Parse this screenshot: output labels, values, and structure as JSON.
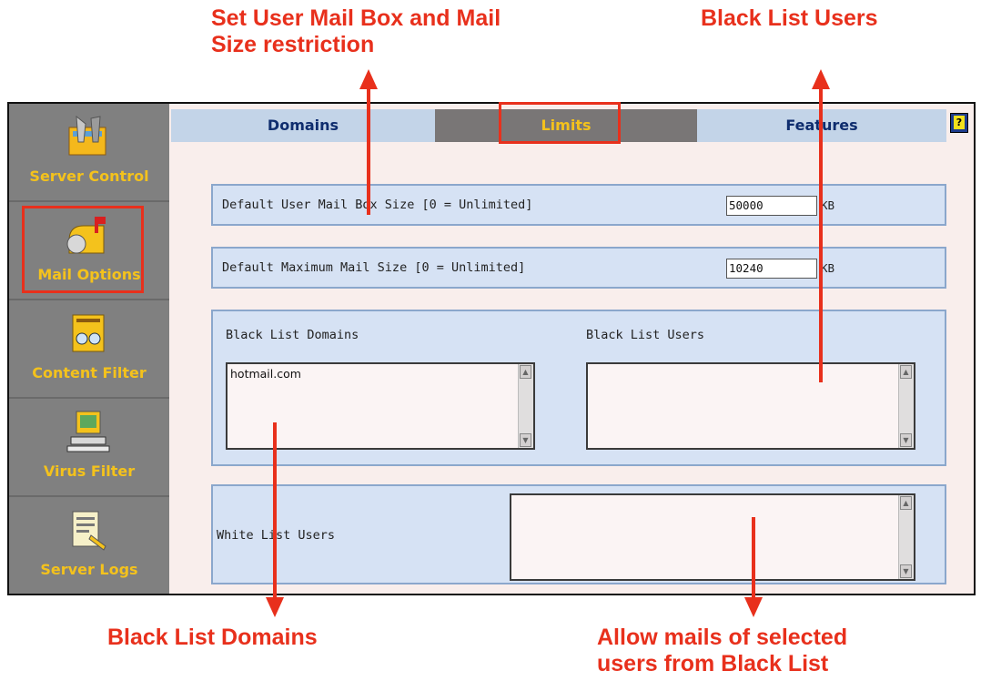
{
  "callouts": {
    "top_left_line1": "Set User Mail Box and Mail",
    "top_left_line2": "Size restriction",
    "top_right": "Black List Users",
    "bottom_left": "Black List Domains",
    "bottom_right_line1": "Allow mails of selected",
    "bottom_right_line2": "users from Black List"
  },
  "sidebar": {
    "items": [
      {
        "label": "Server Control",
        "icon": "server-control-icon"
      },
      {
        "label": "Mail Options",
        "icon": "mailbox-icon"
      },
      {
        "label": "Content Filter",
        "icon": "content-filter-icon"
      },
      {
        "label": "Virus Filter",
        "icon": "virus-filter-icon"
      },
      {
        "label": "Server Logs",
        "icon": "server-logs-icon"
      }
    ]
  },
  "tabs": {
    "domains": "Domains",
    "limits": "Limits",
    "features": "Features",
    "help": "?"
  },
  "limits": {
    "mailbox_size_label": "Default User Mail Box Size [0 = Unlimited]",
    "mailbox_size_value": "50000",
    "mailbox_size_unit": "KB",
    "max_mail_size_label": "Default Maximum Mail Size [0 = Unlimited]",
    "max_mail_size_value": "10240",
    "max_mail_size_unit": "KB"
  },
  "blacklist": {
    "domains_label": "Black List Domains",
    "domains_items": [
      "hotmail.com"
    ],
    "users_label": "Black List Users",
    "users_items": []
  },
  "whitelist": {
    "users_label": "White List Users",
    "users_items": []
  },
  "colors": {
    "callout": "#e8301c",
    "sidebar_bg": "#808080",
    "sidebar_label": "#f4c21c",
    "tab_inactive": "#c3d4e8",
    "tab_active": "#797676",
    "panel_bg": "#d6e2f4"
  }
}
